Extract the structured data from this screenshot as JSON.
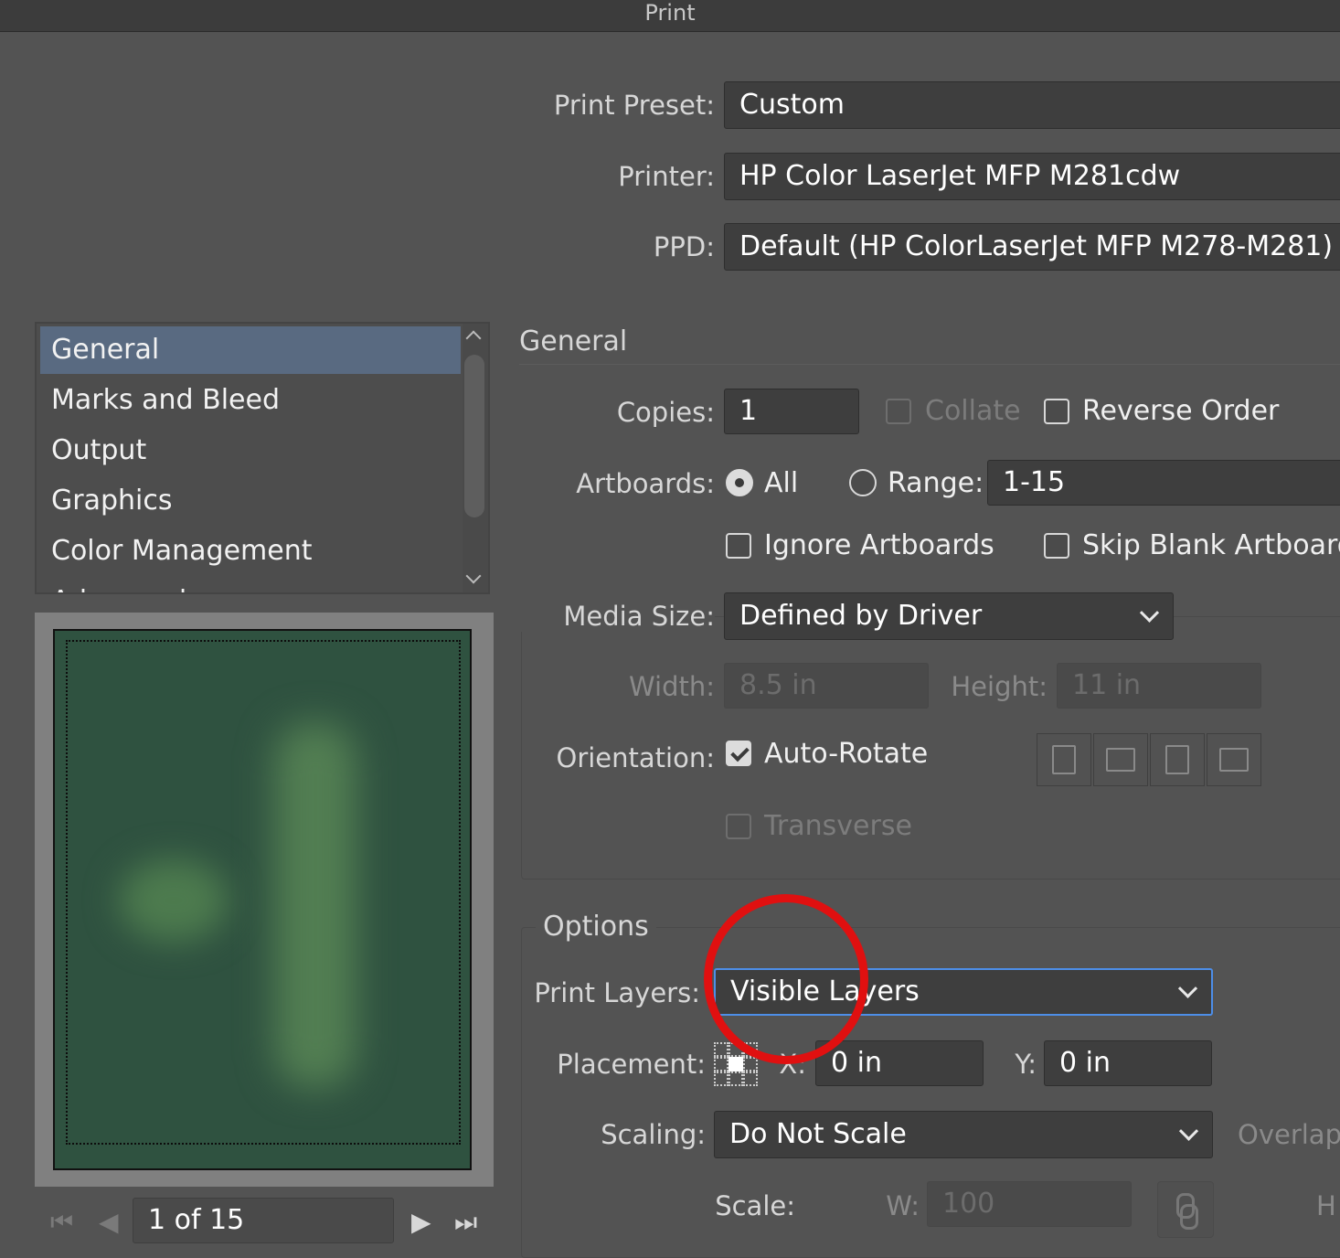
{
  "window": {
    "title": "Print"
  },
  "preset": {
    "label": "Print Preset:",
    "value": "Custom"
  },
  "printer": {
    "label": "Printer:",
    "value": "HP Color LaserJet MFP M281cdw"
  },
  "ppd": {
    "label": "PPD:",
    "value": "Default (HP ColorLaserJet MFP M278-M281)"
  },
  "sidebar": {
    "items": [
      {
        "label": "General",
        "selected": true
      },
      {
        "label": "Marks and Bleed"
      },
      {
        "label": "Output"
      },
      {
        "label": "Graphics"
      },
      {
        "label": "Color Management"
      },
      {
        "label": "Advanced"
      }
    ]
  },
  "general": {
    "title": "General",
    "copies_label": "Copies:",
    "copies_value": "1",
    "collate_label": "Collate",
    "reverse_label": "Reverse Order",
    "artboards_label": "Artboards:",
    "all_label": "All",
    "range_label": "Range:",
    "range_value": "1-15",
    "ignore_label": "Ignore Artboards",
    "skip_label": "Skip Blank Artboards",
    "media_label": "Media Size:",
    "media_value": "Defined by Driver",
    "width_label": "Width:",
    "width_value": "8.5 in",
    "height_label": "Height:",
    "height_value": "11 in",
    "orientation_label": "Orientation:",
    "autorotate_label": "Auto-Rotate",
    "transverse_label": "Transverse"
  },
  "options": {
    "title": "Options",
    "layers_label": "Print Layers:",
    "layers_value": "Visible Layers",
    "placement_label": "Placement:",
    "x_label": "X:",
    "x_value": "0 in",
    "y_label": "Y:",
    "y_value": "0 in",
    "scaling_label": "Scaling:",
    "scaling_value": "Do Not Scale",
    "overlap_label": "Overlap",
    "scale_label": "Scale:",
    "w_label": "W:",
    "w_value": "100",
    "h_label": "H"
  },
  "preview_nav": {
    "page_value": "1 of 15"
  },
  "colors": {
    "accent": "#4d8ee8",
    "selection": "#596a81",
    "annotation": "#e01010",
    "preview_bg": "#2f5240"
  },
  "icons": [
    "chevron-up-icon",
    "chevron-down-icon",
    "first-page-icon",
    "prev-page-icon",
    "next-page-icon",
    "last-page-icon",
    "placement-grid-icon",
    "link-icon",
    "portrait-icon",
    "landscape-icon",
    "portrait-flipped-icon",
    "landscape-flipped-icon"
  ]
}
